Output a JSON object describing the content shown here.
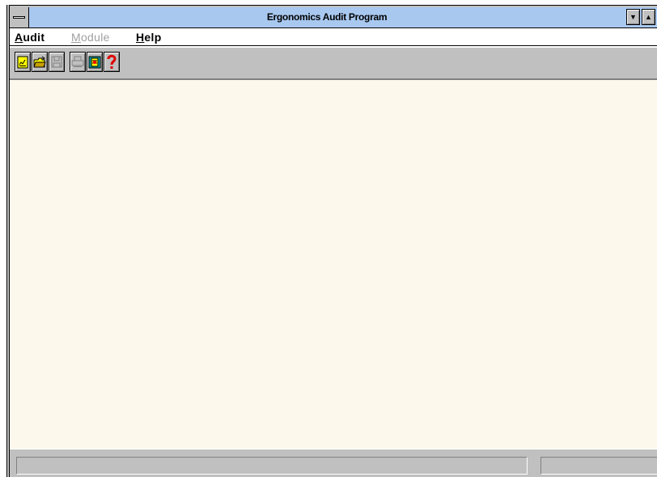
{
  "window": {
    "title": "Ergonomics Audit Program",
    "system_menu_icon": "system-menu-icon",
    "minimize_glyph": "▼",
    "maximize_glyph": "▲"
  },
  "menubar": {
    "items": [
      {
        "label_first": "A",
        "label_rest": "udit",
        "enabled": true
      },
      {
        "label_first": "M",
        "label_rest": "odule",
        "enabled": false
      },
      {
        "label_first": "H",
        "label_rest": "elp",
        "enabled": true
      }
    ]
  },
  "toolbar": {
    "buttons": [
      {
        "icon": "new-audit-icon",
        "enabled": true
      },
      {
        "icon": "open-folder-icon",
        "enabled": true
      },
      {
        "icon": "save-disk-icon",
        "enabled": false
      },
      {
        "icon": "print-icon",
        "enabled": false
      },
      {
        "icon": "module-tool-icon",
        "enabled": true
      },
      {
        "icon": "help-question-icon",
        "enabled": true
      }
    ]
  },
  "client": {
    "background": "#fdf8ec"
  },
  "statusbar": {
    "main_text": "",
    "side_text": ""
  },
  "colors": {
    "titlebar": "#a8c8f0",
    "chrome": "#c0c0c0",
    "disabled_text": "#a0a0a0",
    "help_red": "#e00000"
  }
}
